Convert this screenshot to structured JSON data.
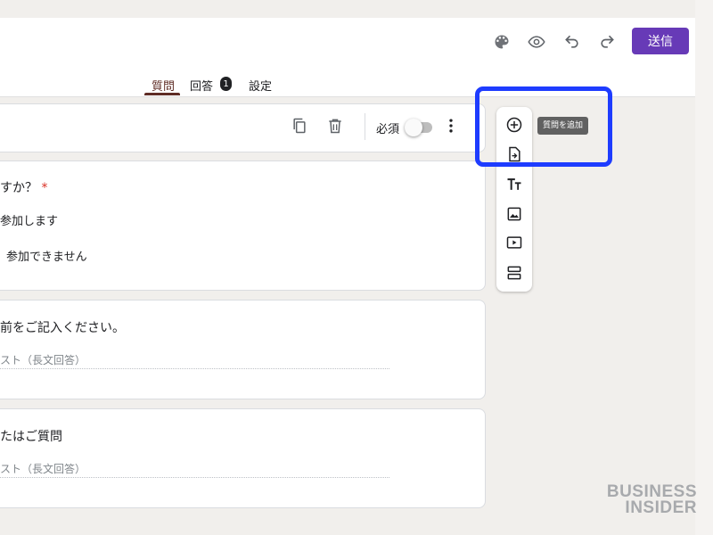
{
  "header": {
    "send_label": "送信",
    "icons": [
      "palette-icon",
      "preview-icon",
      "undo-icon",
      "redo-icon"
    ],
    "tabs": [
      {
        "label": "質問",
        "active": true
      },
      {
        "label": "回答",
        "badge": "1"
      },
      {
        "label": "設定"
      }
    ]
  },
  "toolbar": {
    "required_label": "必須",
    "required_on": false
  },
  "questions": [
    {
      "title": "すか？",
      "required_mark": "*",
      "options": [
        "参加します",
        "参加できません"
      ]
    },
    {
      "title": "前をご記入ください。",
      "placeholder": "スト（長文回答）"
    },
    {
      "title": "たはご質問",
      "placeholder": "スト（長文回答）"
    }
  ],
  "side_toolbar": {
    "items": [
      "add-question-icon",
      "import-questions-icon",
      "add-title-icon",
      "add-image-icon",
      "add-video-icon",
      "add-section-icon"
    ],
    "tooltip": "質問を追加"
  },
  "watermark": {
    "line1": "BUSINESS",
    "line2": "INSIDER"
  },
  "colors": {
    "accent": "#673ab7",
    "highlight": "#1e3cff",
    "active_tab": "#5f2c25",
    "background": "#f1efec"
  }
}
